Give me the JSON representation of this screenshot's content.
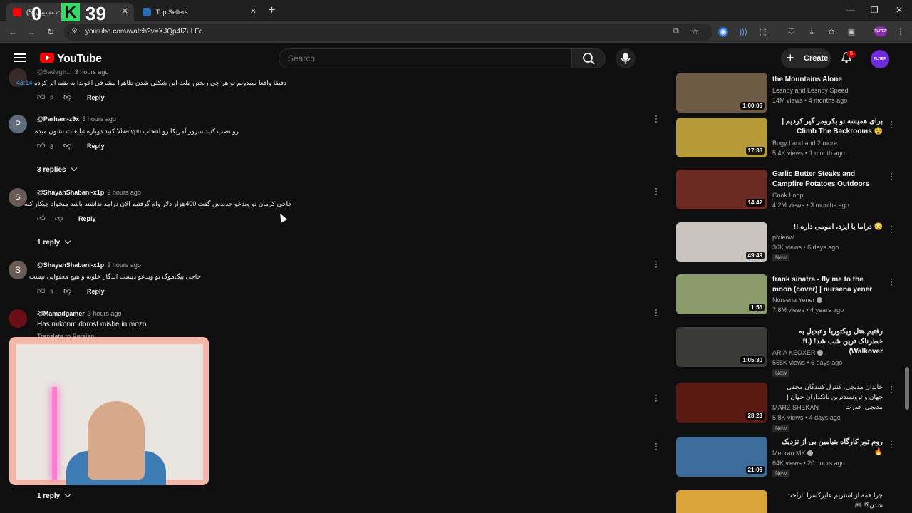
{
  "browser": {
    "tabs": [
      {
        "label": "ست مسي‍بي (5)"
      },
      {
        "label": "Top Sellers"
      }
    ],
    "url": "youtube.com/watch?v=XJQp4IZuLEc",
    "profile_chip": "FLITEP"
  },
  "overlay": {
    "count_left": "0",
    "k_letter": "K",
    "count_right": "39"
  },
  "header": {
    "logo_text": "YouTube",
    "search_placeholder": "Search",
    "create_label": "Create",
    "notifications": "5",
    "avatar_text": "FLITEP"
  },
  "comments": [
    {
      "handle": "@Sadegh...",
      "time": "3 hours ago",
      "text": "دقیقا واقعا نمیدونم تو هر چی ریختن ملت این شکلی شدن ظاهرا بیشرفی اخوندا یه بقیه اثر کرده",
      "timestamp_link": "43:14",
      "likes": "2",
      "reply_label": "Reply"
    },
    {
      "avatar_letter": "P",
      "handle": "@Parham-z9x",
      "time": "3 hours ago",
      "text": "رو نصب کنید سرور آمریکا رو انتخاب Viva vpn کنید دوباره تبلیغات نشون میده",
      "likes": "8",
      "reply_label": "Reply",
      "replies_label": "3 replies"
    },
    {
      "avatar_letter": "S",
      "handle": "@ShayanShabani-x1p",
      "time": "2 hours ago",
      "text": "حاجی کرمان تو ویدعو جدیدش گفت 400هزار دلار وام گرفتیم الان درامد نداشته باشه میخواد چیکار کنه",
      "likes": "",
      "reply_label": "Reply",
      "replies_label": "1 reply"
    },
    {
      "avatar_letter": "S",
      "handle": "@ShayanShabani-x1p",
      "time": "2 hours ago",
      "text": "حاجی بیگ‌موگ تو ویدعو دیست اندگار خلوته و هیچ محتوایی نیست",
      "likes": "3",
      "reply_label": "Reply"
    },
    {
      "handle": "@Mamadgamer",
      "time": "3 hours ago",
      "text": "Has mikonm dorost mishe in mozo",
      "translate": "Translate to Persian"
    }
  ],
  "last_replies_label": "1 reply",
  "recommendations": [
    {
      "title": "the Mountains Alone",
      "channel": "Lesnoy and Lesnoy Speed",
      "meta": "14M views • 4 months ago",
      "duration": "1:00:06",
      "thumb_color": "#6c5a45"
    },
    {
      "title": "برای همیشه تو بکرومز گیر کردیم | 😵 Climb The Backrooms",
      "channel": "Bogy Land and 2 more",
      "meta": "5.4K views • 1 month ago",
      "duration": "17:38",
      "thumb_color": "#b79a3a"
    },
    {
      "title": "Garlic Butter Steaks and Campfire Potatoes Outdoors",
      "channel": "Cook Loop",
      "meta": "4.2M views • 3 months ago",
      "duration": "14:42",
      "thumb_color": "#6b2a24"
    },
    {
      "title": "😳 دراما یا ایزد، امومی داره !!",
      "channel": "pixieow",
      "meta": "30K views • 6 days ago",
      "duration": "49:49",
      "new": "New",
      "thumb_color": "#c9c4bf"
    },
    {
      "title": "frank sinatra - fly me to the moon (cover) | nursena yener",
      "channel": "Nursena Yener",
      "meta": "7.8M views • 4 years ago",
      "duration": "1:56",
      "thumb_color": "#8a9a6a"
    },
    {
      "title": "رفتیم هتل ویکتوریا و تبدیل به خطرناک ترین شب شد! (ft. Walkover)",
      "channel": "ARIA KEOXER",
      "meta": "555K views • 6 days ago",
      "duration": "1:05:30",
      "new": "New",
      "thumb_color": "#3a3a36"
    },
    {
      "title": "خاندان مدیچی، کنترل کنندگان مخفی جهان و ثروتمندترین بانکداران جهان | مدیچی، قدرت",
      "channel": "MARZ SHEKAN",
      "meta": "5.8K views • 4 days ago",
      "duration": "28:23",
      "new": "New",
      "thumb_color": "#5a1a14"
    },
    {
      "title": "روم تور کارگاه بنیامین بی از نزدیک 🔥",
      "channel": "Mehran MK",
      "meta": "64K views • 20 hours ago",
      "duration": "21:06",
      "new": "New",
      "thumb_color": "#3c6d9a"
    },
    {
      "title": "چرا همه از استریم علیرکسرا ناراحت شدن؟! 🎮",
      "channel": "",
      "meta": "",
      "duration": "",
      "thumb_color": "#d9a53a"
    }
  ]
}
